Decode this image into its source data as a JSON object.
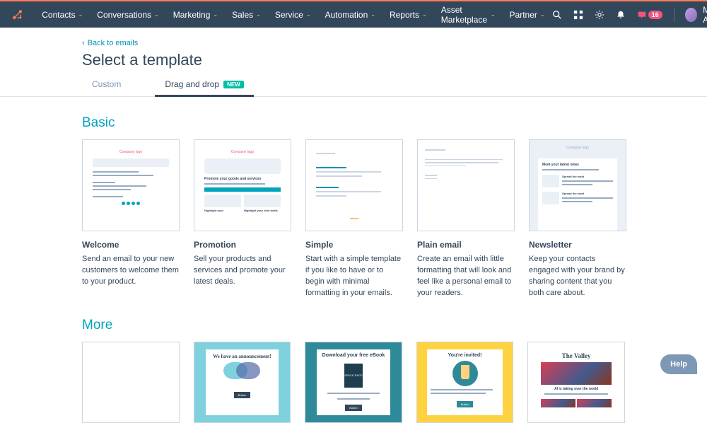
{
  "nav": {
    "items": [
      "Contacts",
      "Conversations",
      "Marketing",
      "Sales",
      "Service",
      "Automation",
      "Reports",
      "Asset Marketplace",
      "Partner"
    ],
    "badge_count": "16",
    "user_name": "MO Agency"
  },
  "page": {
    "back_label": "Back to emails",
    "title": "Select a template"
  },
  "tabs": {
    "custom": "Custom",
    "drag": "Drag and drop",
    "new_badge": "NEW"
  },
  "sections": {
    "basic": "Basic",
    "more": "More"
  },
  "basic_templates": [
    {
      "title": "Welcome",
      "desc": "Send an email to your new customers to welcome them to your product."
    },
    {
      "title": "Promotion",
      "desc": "Sell your products and services and promote your latest deals."
    },
    {
      "title": "Simple",
      "desc": "Start with a simple template if you like to have or to begin with minimal formatting in your emails."
    },
    {
      "title": "Plain email",
      "desc": "Create an email with little formatting that will look and feel like a personal email to your readers."
    },
    {
      "title": "Newsletter",
      "desc": "Keep your contacts engaged with your brand by sharing content that you both care about."
    }
  ],
  "thumb_text": {
    "logo": "Company logo",
    "promo_heading": "Promote your goods and services",
    "promo_h1": "Highlight your",
    "promo_h2": "Highlight your best deals"
  },
  "more_templates": [
    {
      "heading": "We have an announcement!"
    },
    {
      "heading": "Download your free eBook",
      "box": "SPACE RACE"
    },
    {
      "heading": "You're invited!"
    },
    {
      "heading": "The Valley",
      "sub": "AI is taking over the world"
    }
  ],
  "help": "Help"
}
